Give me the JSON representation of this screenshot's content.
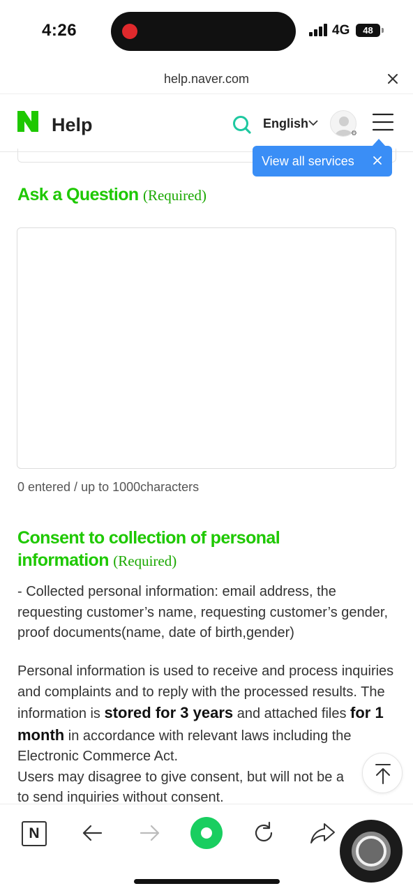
{
  "status_bar": {
    "time": "4:26",
    "network": "4G",
    "battery": "48"
  },
  "url_bar": {
    "domain": "help.naver.com"
  },
  "header": {
    "logo_letter": "N",
    "title": "Help",
    "language": "English",
    "icons": [
      "search-icon",
      "chevron-down-icon",
      "avatar",
      "menu-icon"
    ]
  },
  "tooltip": {
    "label": "View all services"
  },
  "question": {
    "title": "Ask a Question",
    "required": "(Required)",
    "value": "",
    "char_count": "0 entered / up to 1000characters"
  },
  "consent": {
    "title": "Consent to collection of personal information",
    "required": "(Required)",
    "collected": "- Collected personal information: email address, the requesting customer’s name, requesting customer’s gender, proof documents(name, date of birth,gender)",
    "usage_1": "Personal information is used to receive and process inquiries and complaints and to reply with the processed results. The information is",
    "usage_bold_1": "stored for 3 years",
    "usage_2": "and attached files",
    "usage_bold_2": "for 1 month",
    "usage_3": "in accordance with relevant laws including the Electronic Commerce Act.",
    "usage_4_line1": "Users may disagree to give consent, but will not be a",
    "usage_4_line2": "to send inquiries without consent."
  },
  "toolbar": {
    "n_label": "N"
  },
  "colors": {
    "naver_green": "#1ec800",
    "tooltip_blue": "#3a8ef6",
    "toolbar_green": "#19ce60"
  }
}
